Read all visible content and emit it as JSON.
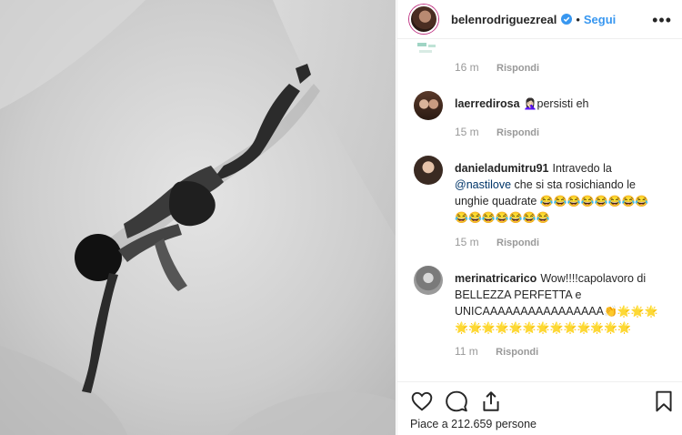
{
  "post": {
    "username": "belenrodriguezreal",
    "follow_label": "Segui",
    "dot": "•",
    "more": "•••"
  },
  "comments": {
    "partial": {
      "time": "16 m",
      "reply": "Rispondi"
    },
    "items": [
      {
        "user": "laerredirosa",
        "text_parts": [
          "🤦🏻‍♀️",
          "persisti eh"
        ],
        "time": "15 m",
        "reply": "Rispondi"
      },
      {
        "user": "danieladumitru91",
        "text_a": "Intravedo la",
        "mention": "@nastilove",
        "text_b": "che si sta rosichiando le unghie quadrate",
        "emojis": "😂😂😂😂😂😂😂😂😂😂😂😂😂😂😂",
        "time": "15 m",
        "reply": "Rispondi"
      },
      {
        "user": "merinatricarico",
        "text_a": "Wow!!!!capolavoro di BELLEZZA PERFETTA e UNICAAAAAAAAAAAAAAAA",
        "emojis": "👏🌟🌟🌟🌟🌟🌟🌟🌟🌟🌟🌟🌟🌟🌟🌟🌟",
        "time": "11 m",
        "reply": "Rispondi"
      }
    ]
  },
  "likes": {
    "text": "Piace a 212.659 persone"
  },
  "icons": [
    "heart-icon",
    "comment-icon",
    "share-icon",
    "bookmark-icon",
    "verified-icon",
    "more-icon"
  ],
  "colors": {
    "accent": "#3897f0",
    "mention": "#003569",
    "muted": "#999999"
  }
}
